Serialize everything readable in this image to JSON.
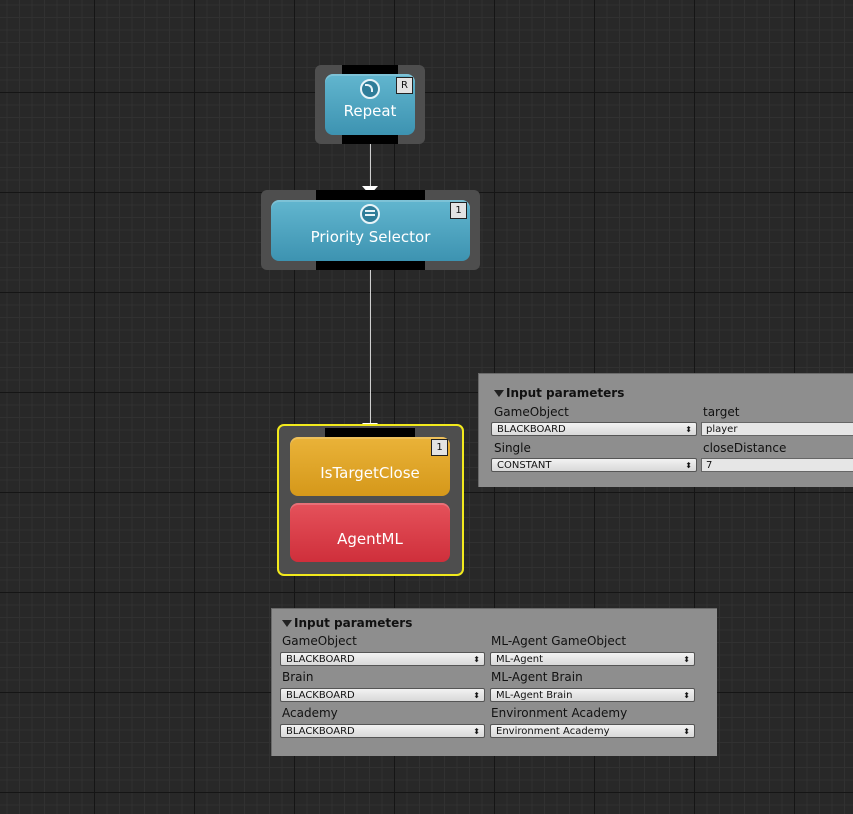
{
  "nodes": {
    "repeat": {
      "label": "Repeat",
      "badge": "R"
    },
    "priority_selector": {
      "label": "Priority Selector",
      "badge": "1"
    },
    "is_target_close": {
      "label": "IsTargetClose",
      "badge": "1"
    },
    "agent_ml": {
      "label": "AgentML"
    }
  },
  "panel_condition": {
    "title": "Input parameters",
    "rows": [
      {
        "type_label": "GameObject",
        "param_label": "target",
        "source": "BLACKBOARD",
        "value": "player"
      },
      {
        "type_label": "Single",
        "param_label": "closeDistance",
        "source": "CONSTANT",
        "value": "7"
      }
    ]
  },
  "panel_action": {
    "title": "Input parameters",
    "rows": [
      {
        "type_label": "GameObject",
        "param_label": "ML-Agent GameObject",
        "source": "BLACKBOARD",
        "value": "ML-Agent"
      },
      {
        "type_label": "Brain",
        "param_label": "ML-Agent Brain",
        "source": "BLACKBOARD",
        "value": "ML-Agent Brain"
      },
      {
        "type_label": "Academy",
        "param_label": "Environment Academy",
        "source": "BLACKBOARD",
        "value": "Environment Academy"
      }
    ]
  },
  "icons": {
    "dropdown_arrow": "⬍",
    "collapse_arrow": "▼"
  },
  "colors": {
    "composite_node": "#4aa3c2",
    "condition_node": "#e0a322",
    "action_node": "#dc3d48",
    "selection_outline": "#f2ea1c"
  }
}
